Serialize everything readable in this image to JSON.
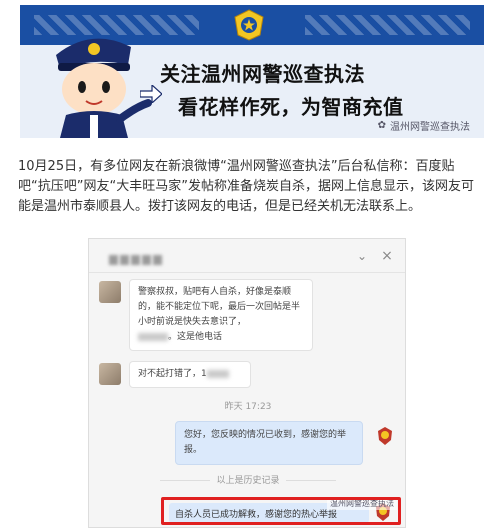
{
  "banner": {
    "headline": "关注温州网警巡查执法",
    "subline": "看花样作死，为智商充值",
    "watermark": "温州网警巡查执法"
  },
  "article": {
    "text": "10月25日，有多位网友在新浪微博“温州网警巡查执法”后台私信称：百度贴吧“抗压吧”网友“大丰旺马家”发帖称准备烧炭自杀，据网上信息显示，该网友可能是温州市泰顺县人。拨打该网友的电话，但是已经关机无法联系上。"
  },
  "chat": {
    "messages": [
      {
        "from": "user",
        "lines": [
          "警察叔叔，贴吧有人自杀，好像是泰顺",
          "的，能不能定位下呢，最后一次回帖是半",
          "小时前说是快失去意识了，"
        ],
        "tail": "。这是他电话"
      },
      {
        "from": "user",
        "text": "对不起打错了，1"
      }
    ],
    "time_label": "昨天 17:23",
    "reply": [
      "您好，您反映的情况已收到，感谢您的举",
      "报。"
    ],
    "history_label": "以上是历史记录",
    "last_message": "自杀人员已成功解救，感谢您的热心举报",
    "watermark": "温州网警巡查执法"
  },
  "colors": {
    "banner_blue": "#1a4fa3",
    "highlight_red": "#e02020",
    "reply_bubble": "#dbe9fb"
  }
}
